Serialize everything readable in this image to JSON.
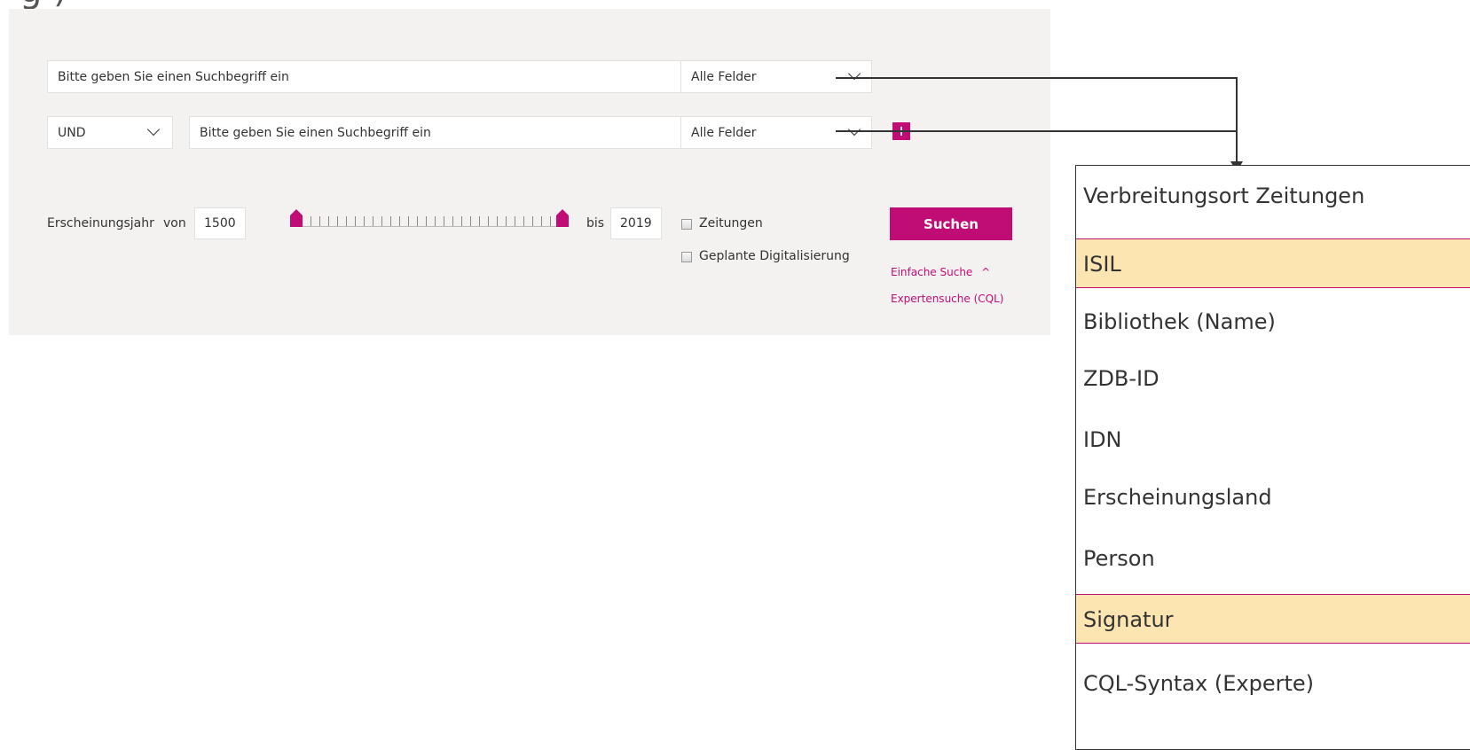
{
  "page": {
    "heading_fragment": "g                              )"
  },
  "search": {
    "row1": {
      "placeholder": "Bitte geben Sie einen Suchbegriff ein",
      "field_select": "Alle Felder"
    },
    "row2": {
      "operator": "UND",
      "placeholder": "Bitte geben Sie einen Suchbegriff ein",
      "field_select": "Alle Felder",
      "add_label": "+"
    }
  },
  "filters": {
    "year_label": "Erscheinungsjahr",
    "from_label": "von",
    "from_value": "1500",
    "to_label": "bis",
    "to_value": "2019",
    "checkboxes": [
      {
        "label": "Zeitungen",
        "checked": false
      },
      {
        "label": "Geplante Digitalisierung",
        "checked": false
      }
    ]
  },
  "actions": {
    "search_label": "Suchen",
    "simple_search": "Einfache Suche",
    "simple_search_chevron": "^",
    "expert_search": "Expertensuche (CQL)"
  },
  "dropdown": {
    "options": [
      {
        "label": "Verbreitungsort Zeitungen",
        "highlighted": false
      },
      {
        "label": "ISIL",
        "highlighted": true
      },
      {
        "label": "Bibliothek (Name)",
        "highlighted": false
      },
      {
        "label": "ZDB-ID",
        "highlighted": false
      },
      {
        "label": "IDN",
        "highlighted": false
      },
      {
        "label": "Erscheinungsland",
        "highlighted": false
      },
      {
        "label": "Person",
        "highlighted": false
      },
      {
        "label": "Signatur",
        "highlighted": true
      },
      {
        "label": "CQL-Syntax (Experte)",
        "highlighted": false
      }
    ]
  },
  "colors": {
    "accent": "#c00d76",
    "highlight": "#fde5b2",
    "panel": "#f4f2f1"
  }
}
